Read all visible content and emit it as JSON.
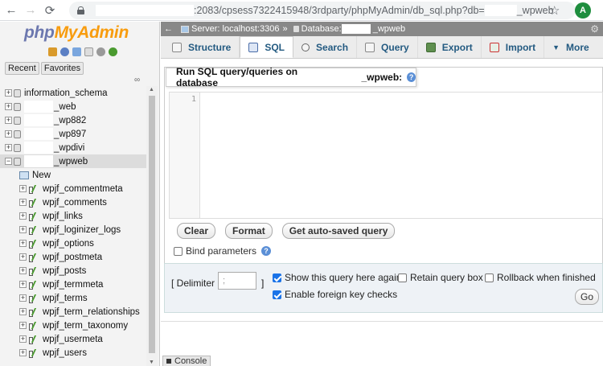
{
  "browser": {
    "url_prefix": ":2083/cpsess7322415948/3rdparty/phpMyAdmin/db_sql.php?db=",
    "url_suffix": "_wpweb",
    "avatar_letter": "A"
  },
  "nav": {
    "logo_php": "php",
    "logo_myadmin": "MyAdmin",
    "recent_label": "Recent",
    "favorites_label": "Favorites",
    "databases": [
      {
        "name": "information_schema",
        "masked": false
      },
      {
        "name": "_web",
        "masked": true
      },
      {
        "name": "_wp882",
        "masked": true
      },
      {
        "name": "_wp897",
        "masked": true
      },
      {
        "name": "_wpdivi",
        "masked": true
      },
      {
        "name": "_wpweb",
        "masked": true,
        "expanded": true
      }
    ],
    "new_label": "New",
    "tables": [
      "wpjf_commentmeta",
      "wpjf_comments",
      "wpjf_links",
      "wpjf_loginizer_logs",
      "wpjf_options",
      "wpjf_postmeta",
      "wpjf_posts",
      "wpjf_termmeta",
      "wpjf_terms",
      "wpjf_term_relationships",
      "wpjf_term_taxonomy",
      "wpjf_usermeta",
      "wpjf_users"
    ]
  },
  "breadcrumb": {
    "server": "Server: localhost:3306",
    "separator": "»",
    "database_label": "Database:",
    "database_suffix": "_wpweb"
  },
  "tabs": [
    {
      "label": "Structure",
      "icon": "structure-icon"
    },
    {
      "label": "SQL",
      "icon": "sql-icon",
      "active": true
    },
    {
      "label": "Search",
      "icon": "search-icon"
    },
    {
      "label": "Query",
      "icon": "query-icon"
    },
    {
      "label": "Export",
      "icon": "export-icon"
    },
    {
      "label": "Import",
      "icon": "import-icon"
    },
    {
      "label": "More",
      "icon": "caret-down-icon"
    }
  ],
  "sql": {
    "header_prefix": "Run SQL query/queries on database",
    "header_db": "_wpweb:",
    "line_number": "1",
    "clear_label": "Clear",
    "format_label": "Format",
    "autosaved_label": "Get auto-saved query",
    "bind_label": "Bind parameters"
  },
  "options": {
    "delimiter_label": "[ Delimiter",
    "delimiter_value": ";",
    "delimiter_close": "]",
    "show_query": "Show this query here again",
    "retain_box": "Retain query box",
    "rollback": "Rollback when finished",
    "foreign_keys": "Enable foreign key checks",
    "go_label": "Go"
  },
  "console_label": "Console"
}
